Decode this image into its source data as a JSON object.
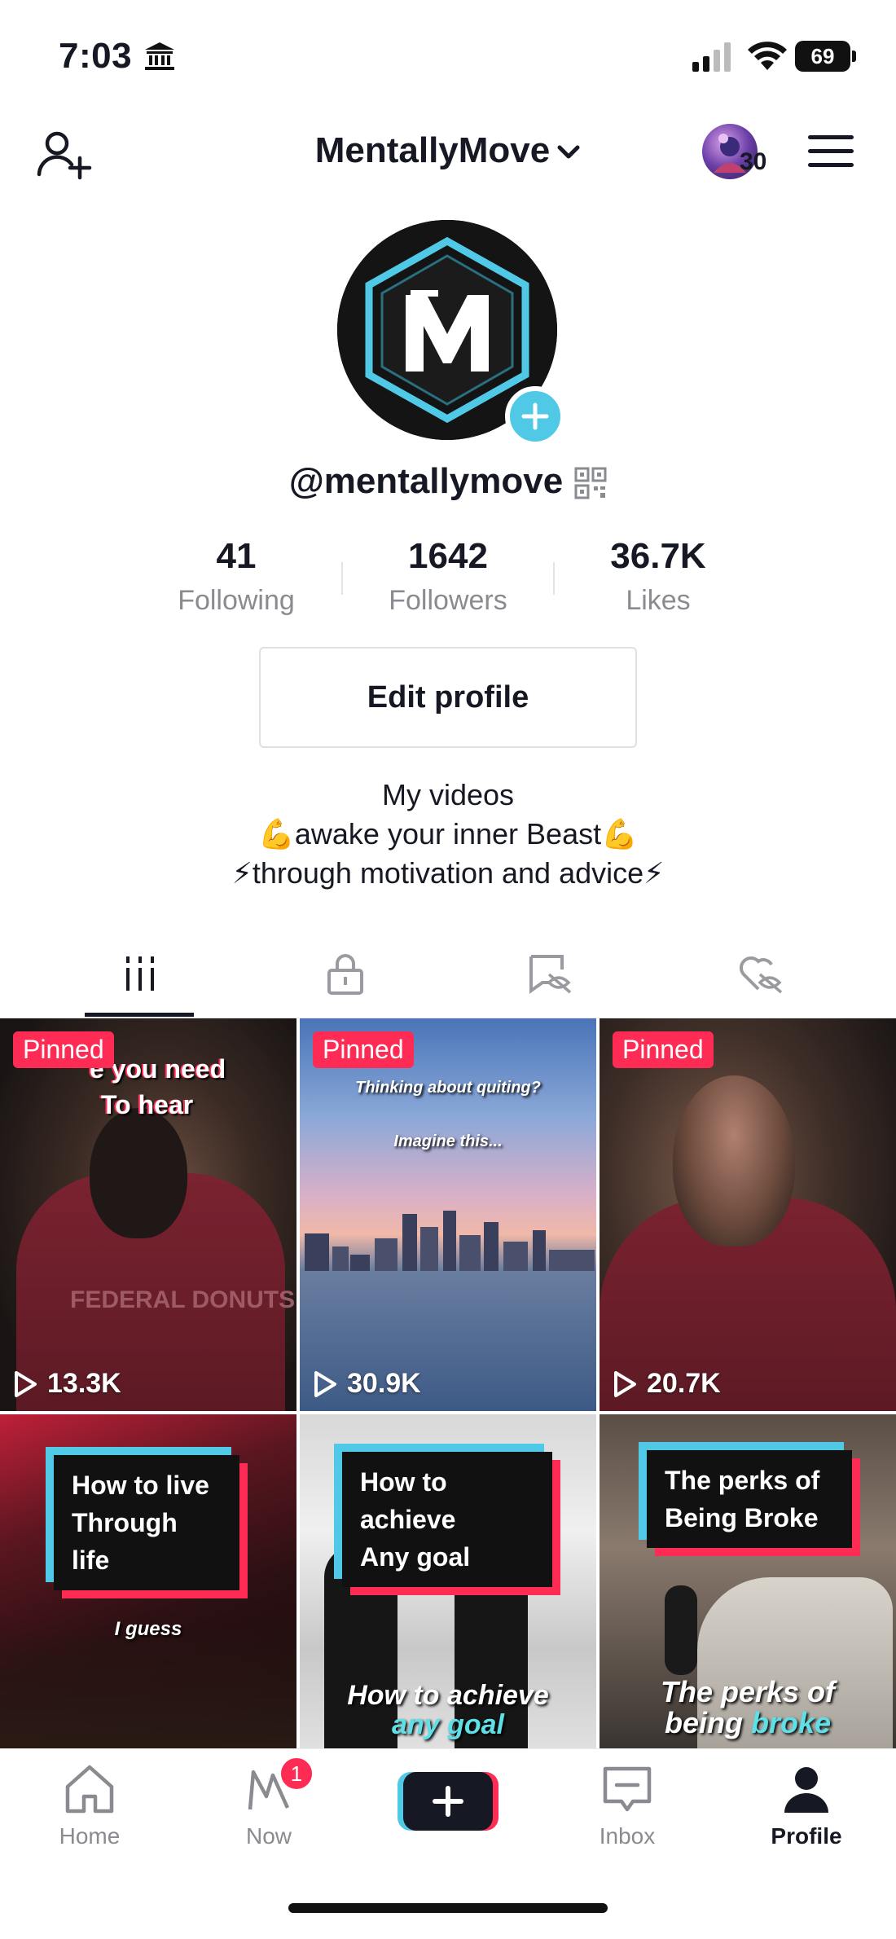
{
  "status_bar": {
    "time": "7:03",
    "battery": "69"
  },
  "header": {
    "account_name": "MentallyMove",
    "notification_count": "30"
  },
  "profile": {
    "username": "@mentallymove",
    "stats": [
      {
        "value": "41",
        "label": "Following"
      },
      {
        "value": "1642",
        "label": "Followers"
      },
      {
        "value": "36.7K",
        "label": "Likes"
      }
    ],
    "edit_button": "Edit profile",
    "bio": [
      "My videos",
      "💪awake your inner Beast💪",
      "⚡through motivation and advice⚡"
    ]
  },
  "tabs": [
    {
      "icon": "grid-videos-icon",
      "active": true
    },
    {
      "icon": "lock-icon",
      "active": false
    },
    {
      "icon": "hidden-post-icon",
      "active": false
    },
    {
      "icon": "hidden-heart-icon",
      "active": false
    }
  ],
  "videos": [
    {
      "pinned_label": "Pinned",
      "views": "13.3K",
      "overlay_top": "e you need",
      "overlay_top2": "To hear",
      "shirt_text": "FEDERAL DONUTS"
    },
    {
      "pinned_label": "Pinned",
      "views": "30.9K",
      "overlay_top": "Thinking about quiting?",
      "overlay_mid": "Imagine this..."
    },
    {
      "pinned_label": "Pinned",
      "views": "20.7K"
    },
    {
      "caption_line1": "How to live",
      "caption_line2": "Through life",
      "overlay_bottom": "I guess"
    },
    {
      "caption_line1": "How to achieve",
      "caption_line2": "Any goal",
      "overlay_bottom1": "How to achieve",
      "overlay_bottom2": "any goal"
    },
    {
      "caption_line1": "The perks of",
      "caption_line2": "Being Broke",
      "overlay_bottom1": "The perks of",
      "overlay_bottom2_a": "being ",
      "overlay_bottom2_b": "broke"
    }
  ],
  "bottom_nav": {
    "home": "Home",
    "now": "Now",
    "now_badge": "1",
    "inbox": "Inbox",
    "profile": "Profile"
  },
  "colors": {
    "accent_red": "#fe2c55",
    "accent_cyan": "#4fc9e6",
    "text": "#161823",
    "muted": "#8a8b91"
  }
}
